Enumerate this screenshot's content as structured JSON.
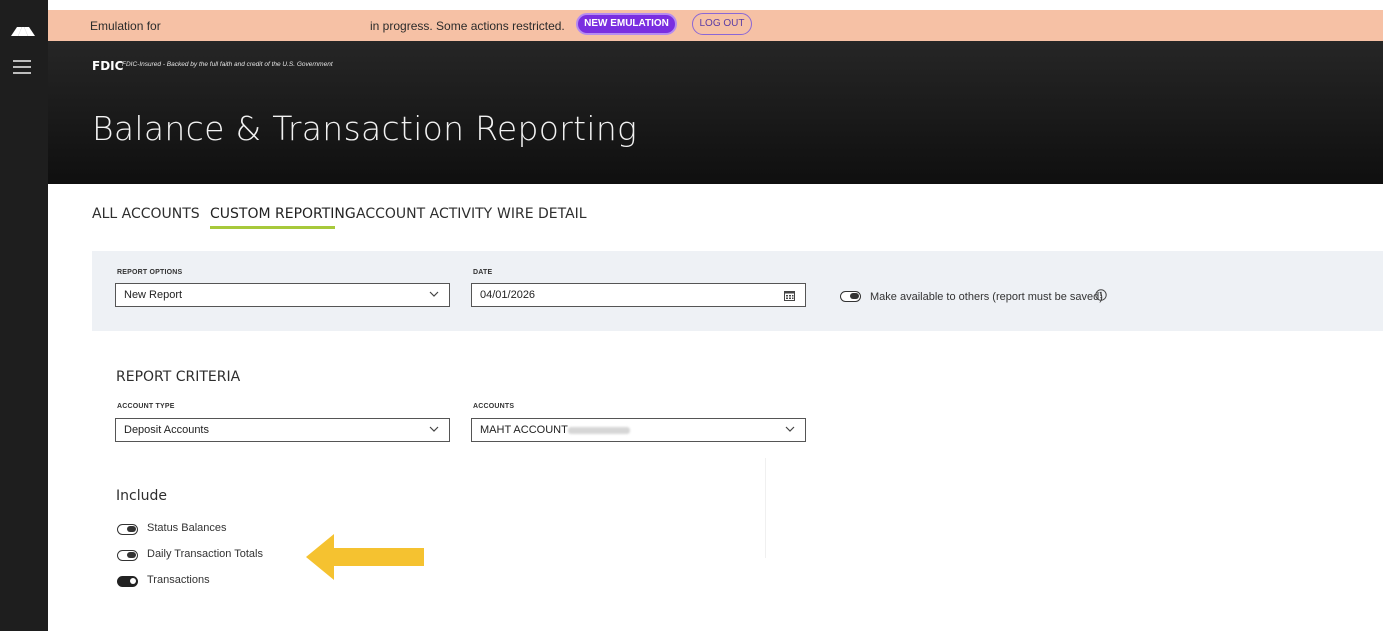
{
  "emulation": {
    "prefix": "Emulation for",
    "suffix": "in progress. Some actions restricted.",
    "new_emulation_label": "NEW EMULATION",
    "logout_label": "LOG OUT"
  },
  "header": {
    "brand": "FDIC",
    "brand_tagline": "FDIC-Insured - Backed by the full faith and credit of the U.S. Government",
    "title": "Balance & Transaction Reporting"
  },
  "tabs": [
    {
      "label": "ALL ACCOUNTS"
    },
    {
      "label": "CUSTOM REPORTING",
      "active": true
    },
    {
      "label": "ACCOUNT ACTIVITY"
    },
    {
      "label": "WIRE DETAIL"
    }
  ],
  "report_options": {
    "label": "REPORT OPTIONS",
    "value": "New Report"
  },
  "date": {
    "label": "DATE",
    "value": "04/01/2026"
  },
  "share_toggle": {
    "label": "Make available to others (report must be saved)",
    "on": false
  },
  "criteria": {
    "title": "REPORT CRITERIA",
    "account_type_label": "ACCOUNT TYPE",
    "account_type_value": "Deposit Accounts",
    "accounts_label": "ACCOUNTS",
    "accounts_value": "MAHT ACCOUNT -"
  },
  "include": {
    "title": "Include",
    "items": [
      {
        "label": "Status Balances",
        "on": false
      },
      {
        "label": "Daily Transaction Totals",
        "on": false
      },
      {
        "label": "Transactions",
        "on": true
      }
    ]
  },
  "colors": {
    "emulation_bar": "#f6c1a5",
    "header_bg": "#1a1a1a",
    "tab_underline": "#a7c93b",
    "new_emulation_pill": "#7a2ee0",
    "arrow": "#f5c230"
  }
}
